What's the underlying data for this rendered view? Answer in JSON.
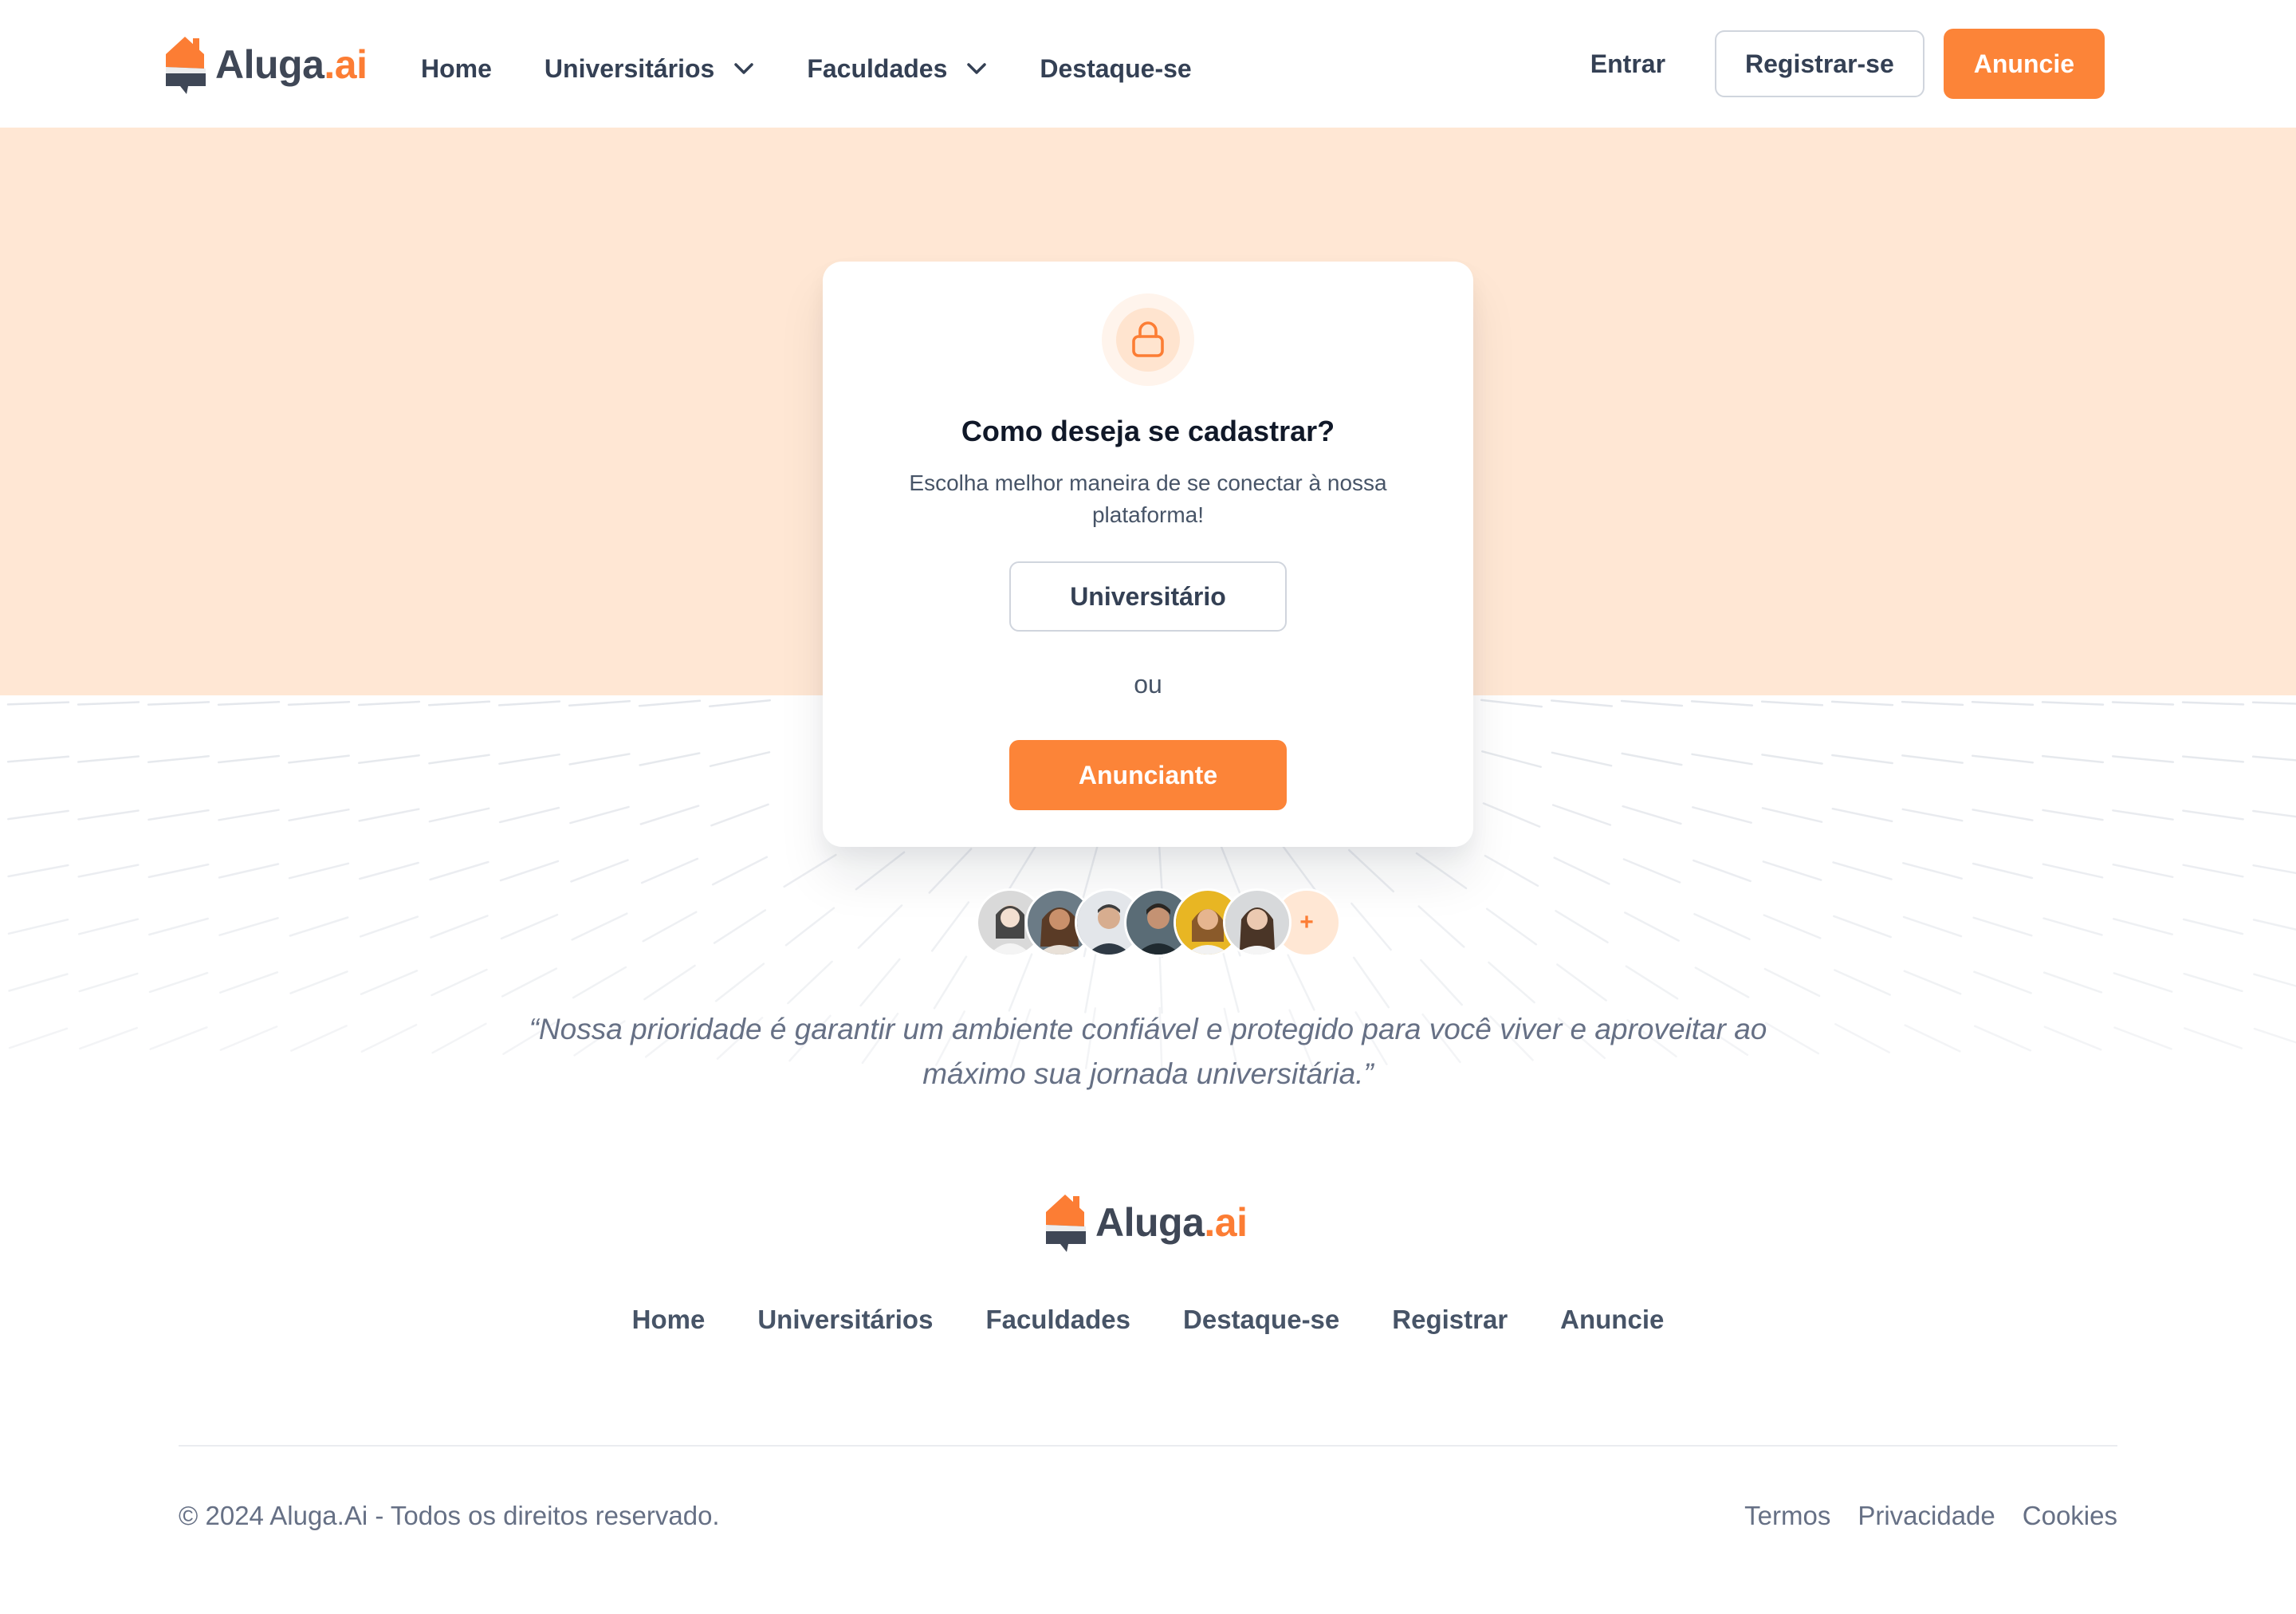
{
  "brand": {
    "name_main": "Aluga",
    "name_accent": ".ai",
    "accent_color": "#fc7d34",
    "text_color": "#3f4756"
  },
  "header": {
    "nav": [
      {
        "label": "Home",
        "has_dropdown": false
      },
      {
        "label": "Universitários",
        "has_dropdown": true
      },
      {
        "label": "Faculdades",
        "has_dropdown": true
      },
      {
        "label": "Destaque-se",
        "has_dropdown": false
      }
    ],
    "login_label": "Entrar",
    "register_label": "Registrar-se",
    "advertise_label": "Anuncie"
  },
  "hero": {
    "background_color": "#ffe7d4",
    "card": {
      "icon": "lock-icon",
      "title": "Como deseja se cadastrar?",
      "subtitle": "Escolha melhor maneira de se conectar à nossa plataforma!",
      "option_student": "Universitário",
      "or_label": "ou",
      "option_advertiser": "Anunciante"
    },
    "avatars_more_label": "+",
    "quote": "“Nossa prioridade é garantir um ambiente confiável e protegido para você viver e aproveitar ao máximo sua jornada universitária.”"
  },
  "footer": {
    "nav": [
      "Home",
      "Universitários",
      "Faculdades",
      "Destaque-se",
      "Registrar",
      "Anuncie"
    ],
    "copyright": "© 2024 Aluga.Ai - Todos os direitos reservado.",
    "legal": [
      "Termos",
      "Privacidade",
      "Cookies"
    ]
  },
  "colors": {
    "primary": "#fc8438",
    "heading": "#101828",
    "body": "#475467",
    "muted": "#667085",
    "border": "#d0d5dd"
  }
}
